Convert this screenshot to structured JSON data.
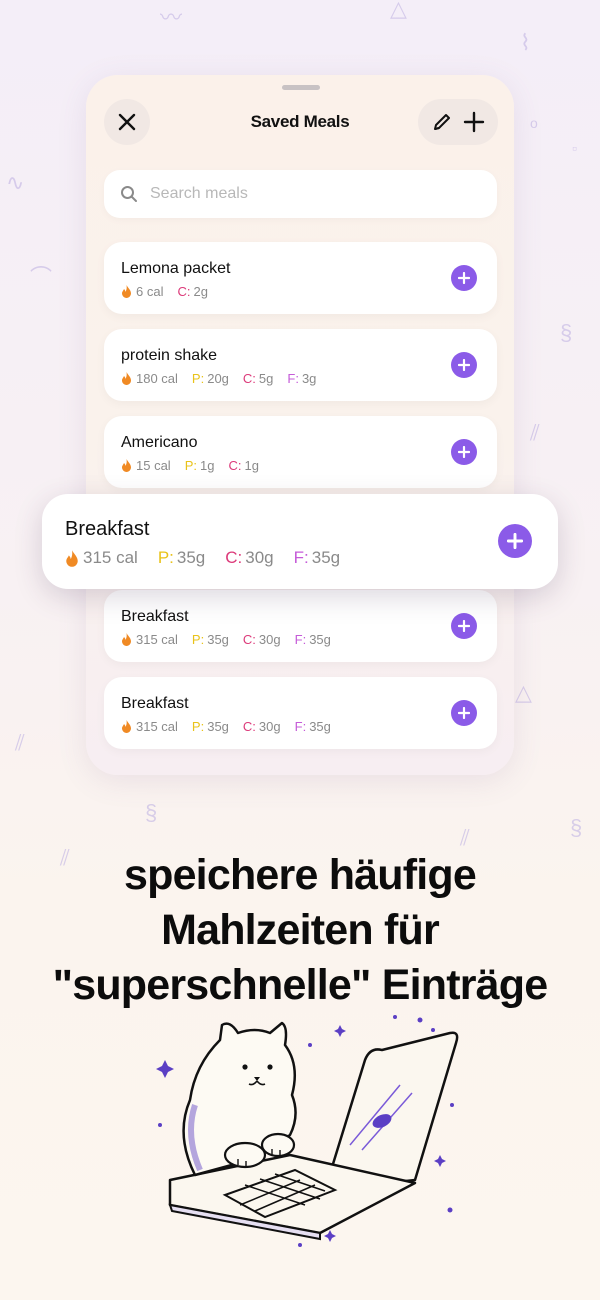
{
  "colors": {
    "accent": "#8b5be8",
    "protein": "#e9c31a",
    "carbs": "#dc3a7a",
    "fat": "#c55bd8",
    "calories": "#f08a24"
  },
  "header": {
    "title": "Saved Meals",
    "close_icon": "close-icon",
    "edit_icon": "pencil-icon",
    "add_icon": "plus-icon"
  },
  "search": {
    "placeholder": "Search meals",
    "value": ""
  },
  "meals": [
    {
      "name": "Lemona packet",
      "cal": "6 cal",
      "c": "2g"
    },
    {
      "name": "protein shake",
      "cal": "180 cal",
      "p": "20g",
      "c": "5g",
      "f": "3g"
    },
    {
      "name": "Americano",
      "cal": "15 cal",
      "p": "1g",
      "c": "1g"
    },
    {
      "name": "Breakfast",
      "cal": "315 cal",
      "p": "35g",
      "c": "30g",
      "f": "35g"
    },
    {
      "name": "Breakfast",
      "cal": "315 cal",
      "p": "35g",
      "c": "30g",
      "f": "35g"
    },
    {
      "name": "Breakfast",
      "cal": "315 cal",
      "p": "35g",
      "c": "30g",
      "f": "35g"
    }
  ],
  "labels": {
    "p": "P:",
    "c": "C:",
    "f": "F:"
  },
  "headline": {
    "line1": "speichere häufige",
    "line2": "Mahlzeiten für",
    "line3": "\"superschnelle\" Einträge"
  },
  "illustration": "cat-with-laptop-illustration"
}
